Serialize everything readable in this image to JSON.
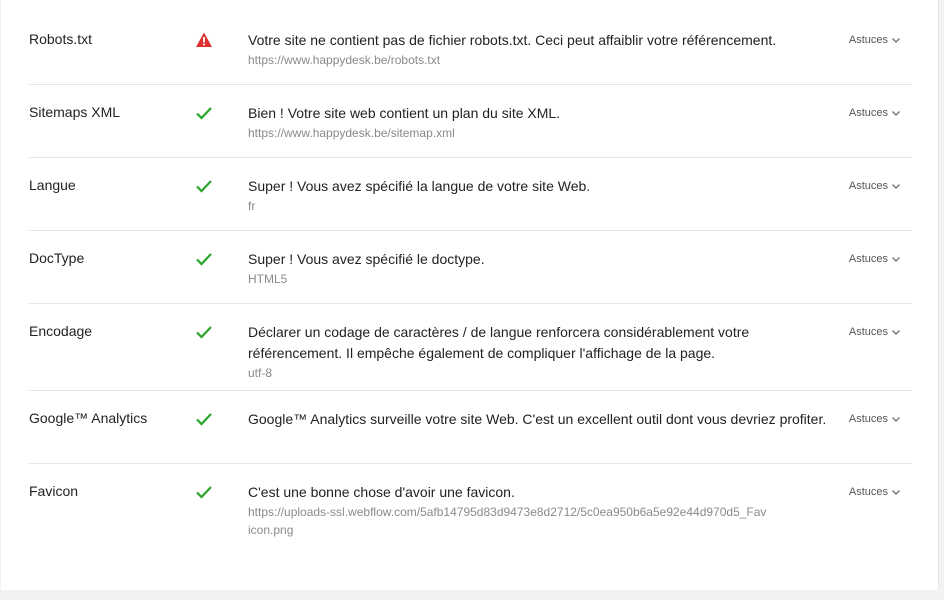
{
  "colors": {
    "ok": "#2aa52a",
    "warn": "#e03131",
    "tips_label": "#555555"
  },
  "rows": [
    {
      "name": "Robots.txt",
      "status_icon": "warning-icon",
      "message": "Votre site ne contient pas de fichier robots.txt. Ceci peut affaiblir votre référencement.",
      "detail": "https://www.happydesk.be/robots.txt",
      "tips_label": "Astuces"
    },
    {
      "name": "Sitemaps XML",
      "status_icon": "check-icon",
      "message": "Bien ! Votre site web contient un plan du site XML.",
      "detail": "https://www.happydesk.be/sitemap.xml",
      "tips_label": "Astuces"
    },
    {
      "name": "Langue",
      "status_icon": "check-icon",
      "message": "Super ! Vous avez spécifié la langue de votre site Web.",
      "detail": "fr",
      "tips_label": "Astuces"
    },
    {
      "name": "DocType",
      "status_icon": "check-icon",
      "message": "Super ! Vous avez spécifié le doctype.",
      "detail": "HTML5",
      "tips_label": "Astuces"
    },
    {
      "name": "Encodage",
      "status_icon": "check-icon",
      "message": "Déclarer un codage de caractères / de langue renforcera considérablement votre référencement. Il empêche également de compliquer l'affichage de la page.",
      "detail": "utf-8",
      "tips_label": "Astuces"
    },
    {
      "name": "Google™ Analytics",
      "status_icon": "check-icon",
      "message": "Google™ Analytics surveille votre site Web. C'est un excellent outil dont vous devriez profiter.",
      "detail": "",
      "tips_label": "Astuces"
    },
    {
      "name": "Favicon",
      "status_icon": "check-icon",
      "message": "C'est une bonne chose d'avoir une favicon.",
      "detail": "https://uploads-ssl.webflow.com/5afb14795d83d9473e8d2712/5c0ea950b6a5e92e44d970d5_Favicon.png",
      "tips_label": "Astuces"
    }
  ]
}
